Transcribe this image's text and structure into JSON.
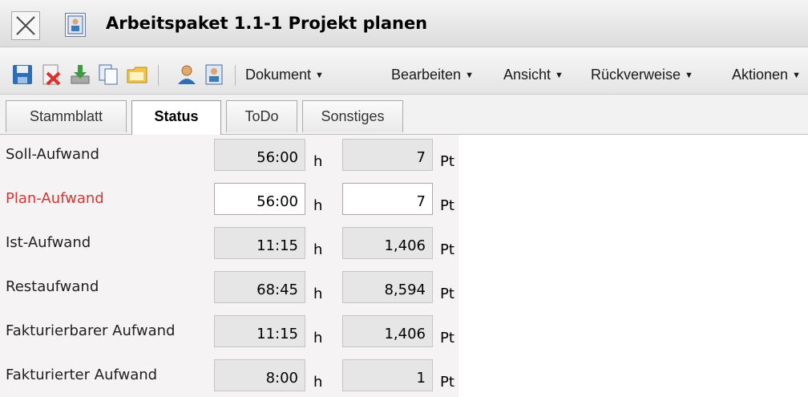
{
  "window": {
    "title": "Arbeitspaket 1.1-1 Projekt planen"
  },
  "toolbar": {
    "icons": [
      "save-icon",
      "delete-icon",
      "download-icon",
      "copy-icon",
      "folder-icon",
      "user-icon",
      "contact-card-icon"
    ],
    "menus": [
      {
        "label": "Dokument"
      },
      {
        "label": "Bearbeiten"
      },
      {
        "label": "Ansicht"
      },
      {
        "label": "Rückverweise"
      },
      {
        "label": "Aktionen"
      }
    ],
    "caret": "▼"
  },
  "tabs": [
    {
      "label": "Stammblatt",
      "active": false
    },
    {
      "label": "Status",
      "active": true
    },
    {
      "label": "ToDo",
      "active": false
    },
    {
      "label": "Sonstiges",
      "active": false
    }
  ],
  "effort": {
    "unit_hours": "h",
    "unit_points": "Pt",
    "rows": [
      {
        "label": "Soll-Aufwand",
        "hours": "56:00",
        "points": "7",
        "editable": false,
        "label_color": "#202020"
      },
      {
        "label": "Plan-Aufwand",
        "hours": "56:00",
        "points": "7",
        "editable": true,
        "label_color": "#d83434"
      },
      {
        "label": "Ist-Aufwand",
        "hours": "11:15",
        "points": "1,406",
        "editable": false,
        "label_color": "#202020"
      },
      {
        "label": "Restaufwand",
        "hours": "68:45",
        "points": "8,594",
        "editable": false,
        "label_color": "#202020"
      },
      {
        "label": "Fakturierbarer Aufwand",
        "hours": "11:15",
        "points": "1,406",
        "editable": false,
        "label_color": "#202020"
      },
      {
        "label": "Fakturierter Aufwand",
        "hours": "8:00",
        "points": "1",
        "editable": false,
        "label_color": "#202020"
      }
    ]
  }
}
